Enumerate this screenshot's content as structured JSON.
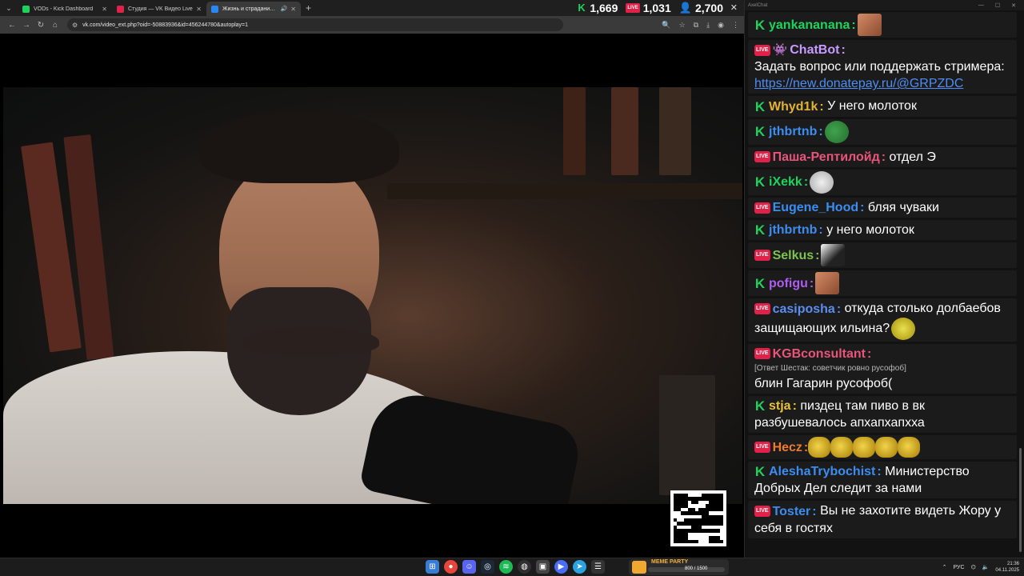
{
  "browser": {
    "tabs": [
      {
        "title": "VODs - Kick Dashboard",
        "favicon_color": "#1dd35c",
        "active": false
      },
      {
        "title": "Студия — VK Видео Live",
        "favicon_color": "#e0224a",
        "active": false
      },
      {
        "title": "Жизнь и страдания Роман…",
        "favicon_color": "#2787f5",
        "active": true
      }
    ],
    "new_tab": "+",
    "url": "vk.com/video_ext.php?oid=-50883936&id=456244780&autoplay=1"
  },
  "stats": {
    "kick_viewers": "1,669",
    "vk_viewers": "1,031",
    "total_viewers": "2,700",
    "live_badge": "LIVE"
  },
  "chat": {
    "title": "AxelChat",
    "messages": [
      {
        "platform": "kick",
        "user": "yankananana",
        "user_color": "#1dd35c",
        "text": "",
        "emote": "face"
      },
      {
        "platform": "live",
        "bot": true,
        "user": "ChatBot",
        "user_color": "#c79bff",
        "text": "Задать вопрос или поддержать стримера:",
        "link": "https://new.donatepay.ru/@GRPZDC"
      },
      {
        "platform": "kick",
        "user": "Whyd1k",
        "user_color": "#e3b32f",
        "text": "У него молоток"
      },
      {
        "platform": "kick",
        "user": "jthbrtnb",
        "user_color": "#3c8df0",
        "text": "",
        "emote": "pepe"
      },
      {
        "platform": "live",
        "user": "Паша-Рептилойд",
        "user_color": "#e9557a",
        "text": "отдел Э"
      },
      {
        "platform": "kick",
        "user": "iXekk",
        "user_color": "#1dd35c",
        "text": "",
        "emote": "cat"
      },
      {
        "platform": "live",
        "user": "Eugene_Hood",
        "user_color": "#3c8df0",
        "text": "бляя чуваки"
      },
      {
        "platform": "kick",
        "user": "jthbrtnb",
        "user_color": "#3c8df0",
        "text": "у него молоток"
      },
      {
        "platform": "live",
        "user": "Selkus",
        "user_color": "#7ec24f",
        "text": "",
        "emote": "bw"
      },
      {
        "platform": "kick",
        "user": "pofigu",
        "user_color": "#b05cf0",
        "text": "",
        "emote": "face"
      },
      {
        "platform": "live",
        "user": "casiposha",
        "user_color": "#5a8ff0",
        "text": "откуда столько долбаебов защищающих ильина?",
        "emote": "duck"
      },
      {
        "platform": "live",
        "user": "KGBconsultant",
        "user_color": "#e9557a",
        "reply": "[Ответ Шестак: советчик ровно русофоб]",
        "text": "блин Гагарин русофоб("
      },
      {
        "platform": "kick",
        "user": "stja",
        "user_color": "#e8c03a",
        "text": "пиздец там пиво в вк разбушевалось апхапхапхха"
      },
      {
        "platform": "live",
        "user": "Hecz",
        "user_color": "#f07a2f",
        "text": "",
        "emote": "coins"
      },
      {
        "platform": "kick",
        "user": "AleshaTrybochist",
        "user_color": "#3c8df0",
        "text": "Министерство Добрых Дел следит за нами"
      },
      {
        "platform": "live",
        "user": "Toster",
        "user_color": "#3c8df0",
        "text": "Вы не захотите видеть Жору у себя в гостях"
      }
    ]
  },
  "taskbar": {
    "widget_title": "MEME PARTY",
    "widget_count": "800 / 1500",
    "language": "РУС",
    "time": "21:36",
    "date": "04.11.2025"
  }
}
